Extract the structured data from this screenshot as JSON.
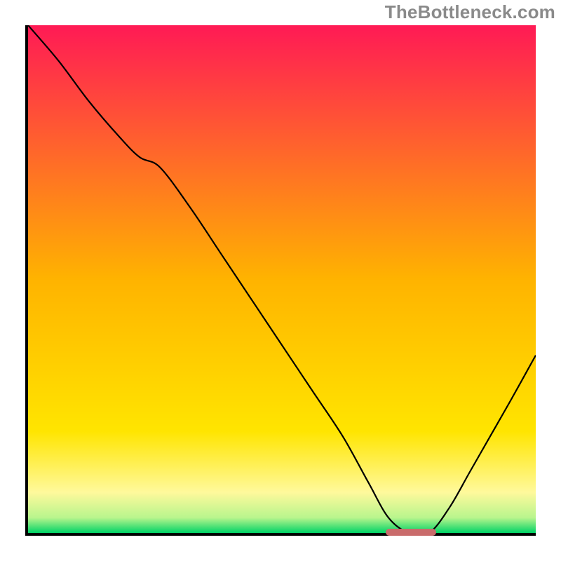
{
  "watermark": "TheBottleneck.com",
  "chart_data": {
    "type": "line",
    "title": "",
    "xlabel": "",
    "ylabel": "",
    "xlim": [
      0,
      100
    ],
    "ylim": [
      0,
      100
    ],
    "grid": false,
    "legend": false,
    "background": {
      "type": "vertical_gradient",
      "stops": [
        {
          "pos": 0,
          "color": "#ff1a55"
        },
        {
          "pos": 50,
          "color": "#ffb300"
        },
        {
          "pos": 80,
          "color": "#ffe500"
        },
        {
          "pos": 92,
          "color": "#fff99c"
        },
        {
          "pos": 97,
          "color": "#b8f58d"
        },
        {
          "pos": 100,
          "color": "#00d366"
        }
      ]
    },
    "series": [
      {
        "name": "bottleneck-curve",
        "color": "#000000",
        "x": [
          0,
          6,
          12,
          18,
          22,
          26,
          32,
          38,
          44,
          50,
          56,
          62,
          67,
          71,
          75,
          79,
          83,
          87,
          91,
          95,
          100
        ],
        "y": [
          100,
          93,
          85,
          78,
          74,
          72,
          64,
          55,
          46,
          37,
          28,
          19,
          10,
          3,
          0,
          0,
          5,
          12,
          19,
          26,
          35
        ]
      }
    ],
    "annotations": [
      {
        "name": "minimum-region",
        "type": "segment",
        "x_start": 70,
        "x_end": 80,
        "y": 0.7,
        "color": "#c96b6b"
      }
    ]
  }
}
